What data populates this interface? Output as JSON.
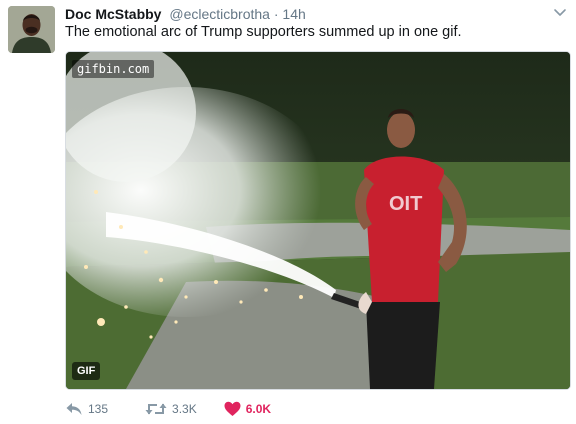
{
  "tweet": {
    "author_name": "Doc McStabby",
    "author_handle": "@eclecticbrotha",
    "separator": "·",
    "time": "14h",
    "text": "The emotional arc of Trump supporters summed up in one gif."
  },
  "media": {
    "watermark": "gifbin.com",
    "badge": "GIF",
    "shirt_text": "OIT"
  },
  "actions": {
    "reply_count": "135",
    "retweet_count": "3.3K",
    "like_count": "6.0K"
  },
  "icons": {
    "avatar": "avatar",
    "caret": "chevron-down-icon",
    "reply": "reply-icon",
    "retweet": "retweet-icon",
    "like": "heart-icon"
  },
  "colors": {
    "like_accent": "#e0245e",
    "muted": "#657786",
    "text": "#14171a"
  }
}
